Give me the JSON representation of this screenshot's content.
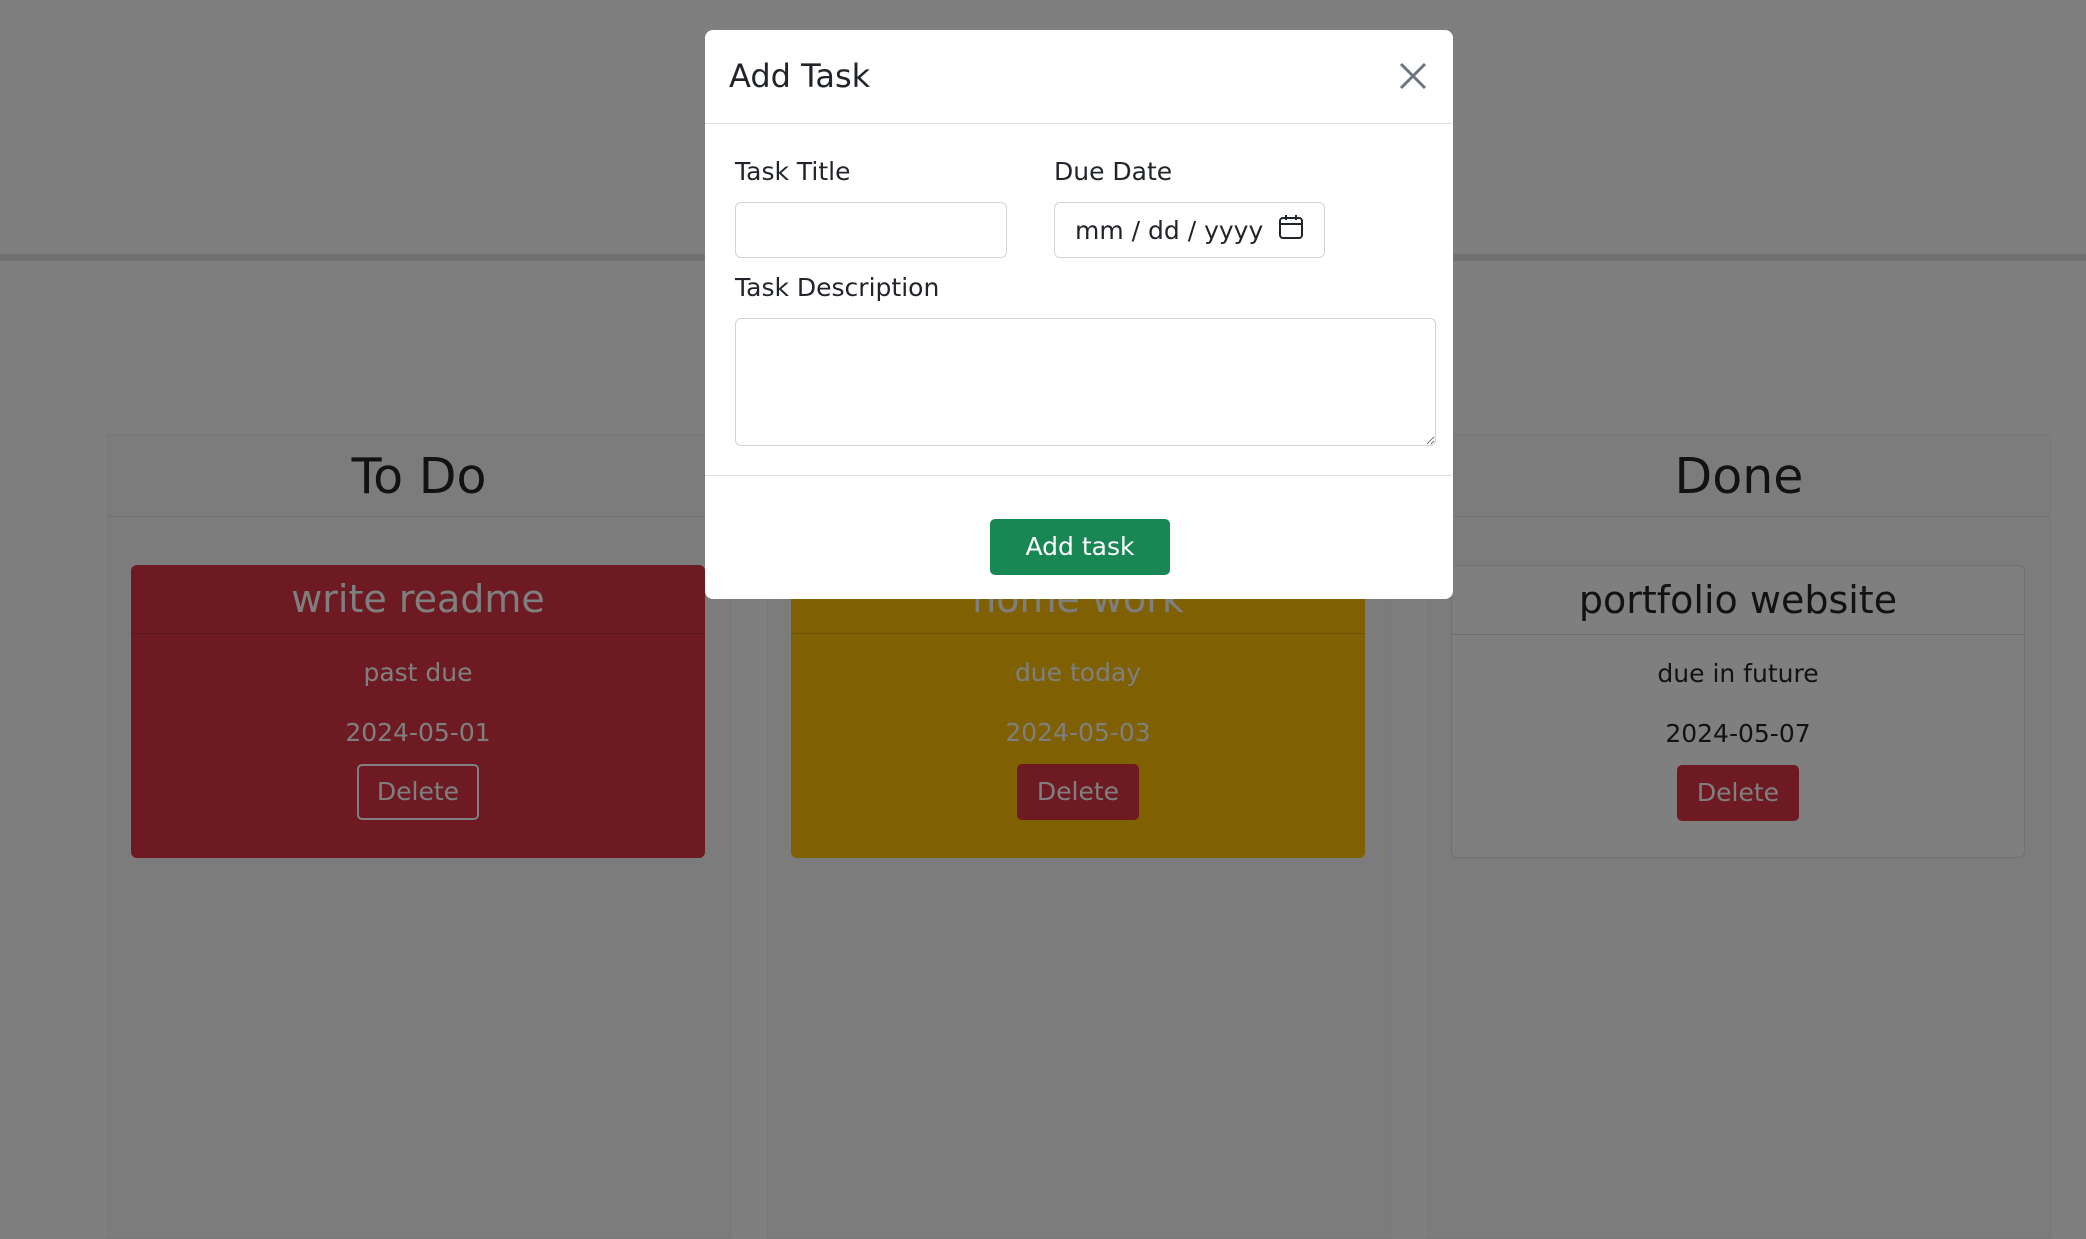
{
  "lanes": [
    {
      "heading": "To Do",
      "card": {
        "title": "write readme",
        "status": "past due",
        "date": "2024-05-01",
        "delete_label": "Delete",
        "color": "#dc3545"
      }
    },
    {
      "heading": "",
      "card": {
        "title": "home work",
        "status": "due today",
        "date": "2024-05-03",
        "delete_label": "Delete",
        "color": "#ffc107"
      }
    },
    {
      "heading": "Done",
      "card": {
        "title": "portfolio website",
        "status": "due in future",
        "date": "2024-05-07",
        "delete_label": "Delete",
        "color": "#ffffff"
      }
    }
  ],
  "modal": {
    "title": "Add Task",
    "close_icon": "close-icon",
    "task_title_label": "Task Title",
    "task_title_value": "",
    "due_date_label": "Due Date",
    "due_date_placeholder": "mm / dd / yyyy",
    "calendar_icon": "calendar-icon",
    "task_description_label": "Task Description",
    "task_description_value": "",
    "add_button_label": "Add task"
  },
  "colors": {
    "danger": "#dc3545",
    "warning": "#ffc107",
    "success": "#198754",
    "backdrop": "rgba(0,0,0,0.5)"
  }
}
